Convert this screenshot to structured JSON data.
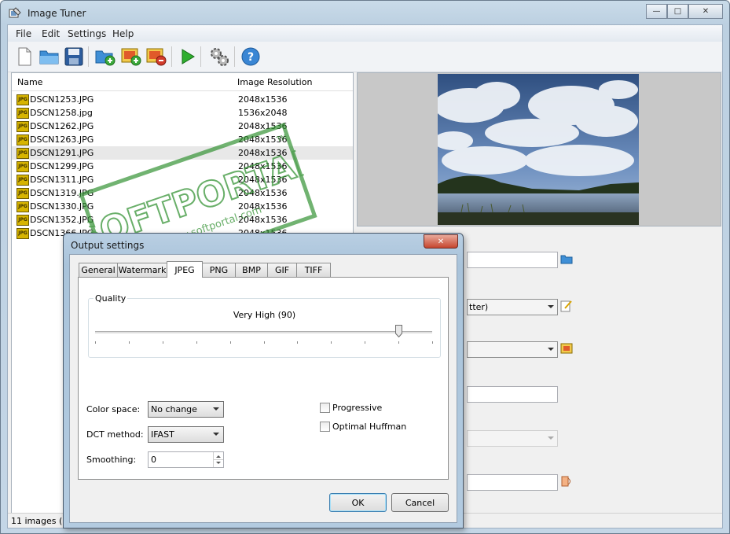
{
  "window": {
    "title": "Image Tuner"
  },
  "menu": [
    "File",
    "Edit",
    "Settings",
    "Help"
  ],
  "toolbar": {
    "buttons": [
      "new-file-icon",
      "open-folder-icon",
      "save-icon",
      "add-folder-icon",
      "add-image-icon",
      "remove-image-icon",
      "run-icon",
      "settings-gears-icon",
      "help-icon"
    ]
  },
  "list": {
    "columns": {
      "name": "Name",
      "resolution": "Image Resolution"
    },
    "file_badge": "JPG",
    "rows": [
      {
        "name": "DSCN1253.JPG",
        "res": "2048x1536"
      },
      {
        "name": "DSCN1258.jpg",
        "res": "1536x2048"
      },
      {
        "name": "DSCN1262.JPG",
        "res": "2048x1536"
      },
      {
        "name": "DSCN1263.JPG",
        "res": "2048x1536"
      },
      {
        "name": "DSCN1291.JPG",
        "res": "2048x1536",
        "selected": true
      },
      {
        "name": "DSCN1299.JPG",
        "res": "2048x1536"
      },
      {
        "name": "DSCN1311.JPG",
        "res": "2048x1536"
      },
      {
        "name": "DSCN1319.JPG",
        "res": "2048x1536"
      },
      {
        "name": "DSCN1330.JPG",
        "res": "2048x1536"
      },
      {
        "name": "DSCN1352.JPG",
        "res": "2048x1536"
      },
      {
        "name": "DSCN1366.JPG",
        "res": "2048x1536"
      }
    ]
  },
  "right_panel": {
    "dropdown1_text": "tter)"
  },
  "status": {
    "text": "11 images (1"
  },
  "dialog": {
    "title": "Output settings",
    "tabs": [
      "General",
      "Watermark",
      "JPEG",
      "PNG",
      "BMP",
      "GIF",
      "TIFF"
    ],
    "active_tab": "JPEG",
    "quality": {
      "group_label": "Quality",
      "value_text": "Very High (90)",
      "value": 90
    },
    "color_space": {
      "label": "Color space:",
      "value": "No change"
    },
    "dct_method": {
      "label": "DCT method:",
      "value": "IFAST"
    },
    "smoothing": {
      "label": "Smoothing:",
      "value": "0"
    },
    "progressive": {
      "label": "Progressive",
      "checked": false
    },
    "optimal_huffman": {
      "label": "Optimal Huffman",
      "checked": false
    },
    "ok_label": "OK",
    "cancel_label": "Cancel"
  },
  "watermark": {
    "text": "SOFTPORTAL",
    "url": "www.softportal.com",
    "tm": "TM"
  }
}
